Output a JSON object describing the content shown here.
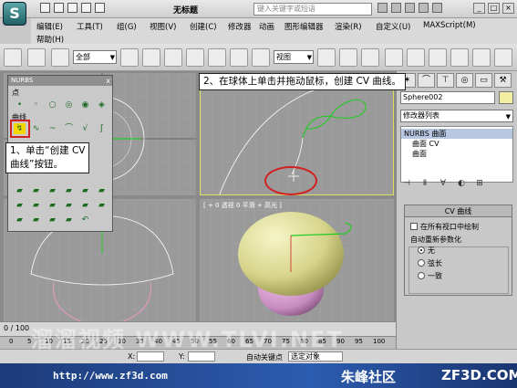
{
  "titlebar": {
    "app_logo": "S",
    "doc_title": "无标题",
    "search_placeholder": "键入关键字或短语"
  },
  "menu": {
    "row1": [
      "编辑(E)",
      "工具(T)",
      "组(G)",
      "视图(V)",
      "创建(C)",
      "修改器",
      "动画",
      "图形编辑器",
      "渲染(R)",
      "自定义(U)",
      "MAXScript(M)"
    ],
    "row2": [
      "帮助(H)"
    ]
  },
  "toolbar": {
    "selection_filter": "全部",
    "view_dropdown": "视图"
  },
  "nurbs_panel": {
    "title": "NURBS",
    "close": "x",
    "section_point": "点",
    "section_curve": "曲线"
  },
  "callouts": {
    "step1_line1": "1、单击“创建 CV",
    "step1_line2": "曲线”按钮。",
    "step2": "2、在球体上单击并拖动鼠标，创建 CV 曲线。"
  },
  "viewports": {
    "perspective_label": "[ + 0 透视 0 平滑 + 高光 ]"
  },
  "command_panel": {
    "object_name": "Sphere002",
    "modifier_list": "修改器列表",
    "stack": [
      "NURBS 曲面",
      "曲面 CV",
      "曲面"
    ],
    "rollout_title": "CV 曲线",
    "draw_all_viewports": "在所有视口中绘制",
    "reparam_label": "自动重新参数化",
    "radio_none": "无",
    "radio_chord": "弦长",
    "radio_uniform": "一致"
  },
  "timeline": {
    "frame": "0 / 100",
    "ticks": [
      "0",
      "5",
      "10",
      "15",
      "20",
      "25",
      "30",
      "35",
      "40",
      "45",
      "50",
      "55",
      "60",
      "65",
      "70",
      "75",
      "80",
      "85",
      "90",
      "95",
      "100"
    ]
  },
  "statusbar": {
    "x_label": "X:",
    "y_label": "Y:",
    "auto_key": "自动关键点",
    "selected_object": "选定对象"
  },
  "bottom": {
    "url": "http://www.zf3d.com",
    "brand_cn": "朱峰社区",
    "brand_en": "ZF3D.COM"
  },
  "watermark": "溜溜视频 WWW.TLVI.NET",
  "colors": {
    "accent_red": "#d02020",
    "curve_green": "#22cc22",
    "bottom_bar": "#2c5cb0"
  }
}
